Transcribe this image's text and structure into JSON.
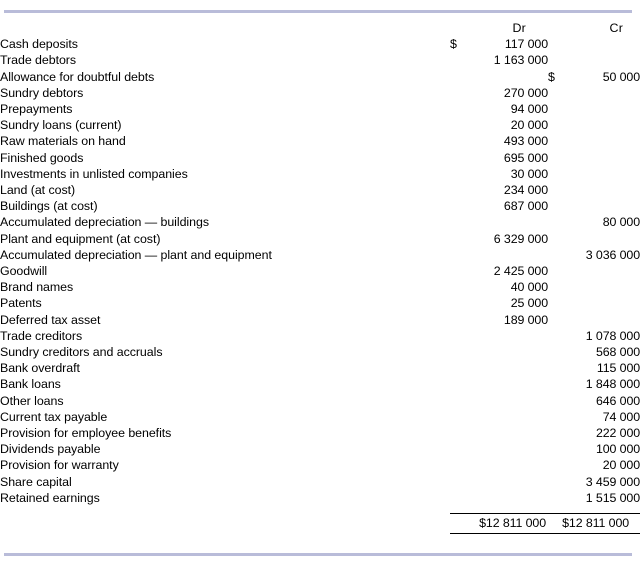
{
  "table": {
    "columns": {
      "label_header": "",
      "dr_header": "Dr",
      "cr_header": "Cr"
    },
    "currency_symbol": "$",
    "rows": [
      {
        "label": "Cash deposits",
        "dr_symbol": "$",
        "dr": "117 000",
        "cr_symbol": "",
        "cr": ""
      },
      {
        "label": "Trade debtors",
        "dr_symbol": "",
        "dr": "1 163 000",
        "cr_symbol": "",
        "cr": ""
      },
      {
        "label": "Allowance for doubtful debts",
        "dr_symbol": "",
        "dr": "",
        "cr_symbol": "$",
        "cr": "50 000"
      },
      {
        "label": "Sundry debtors",
        "dr_symbol": "",
        "dr": "270 000",
        "cr_symbol": "",
        "cr": ""
      },
      {
        "label": "Prepayments",
        "dr_symbol": "",
        "dr": "94 000",
        "cr_symbol": "",
        "cr": ""
      },
      {
        "label": "Sundry loans (current)",
        "dr_symbol": "",
        "dr": "20 000",
        "cr_symbol": "",
        "cr": ""
      },
      {
        "label": "Raw materials on hand",
        "dr_symbol": "",
        "dr": "493 000",
        "cr_symbol": "",
        "cr": ""
      },
      {
        "label": "Finished goods",
        "dr_symbol": "",
        "dr": "695 000",
        "cr_symbol": "",
        "cr": ""
      },
      {
        "label": "Investments in unlisted companies",
        "dr_symbol": "",
        "dr": "30 000",
        "cr_symbol": "",
        "cr": ""
      },
      {
        "label": "Land (at cost)",
        "dr_symbol": "",
        "dr": "234 000",
        "cr_symbol": "",
        "cr": ""
      },
      {
        "label": "Buildings (at cost)",
        "dr_symbol": "",
        "dr": "687 000",
        "cr_symbol": "",
        "cr": ""
      },
      {
        "label": "Accumulated depreciation — buildings",
        "dr_symbol": "",
        "dr": "",
        "cr_symbol": "",
        "cr": "80 000"
      },
      {
        "label": "Plant and equipment (at cost)",
        "dr_symbol": "",
        "dr": "6 329 000",
        "cr_symbol": "",
        "cr": ""
      },
      {
        "label": "Accumulated depreciation — plant and equipment",
        "dr_symbol": "",
        "dr": "",
        "cr_symbol": "",
        "cr": "3 036 000"
      },
      {
        "label": "Goodwill",
        "dr_symbol": "",
        "dr": "2 425 000",
        "cr_symbol": "",
        "cr": ""
      },
      {
        "label": "Brand names",
        "dr_symbol": "",
        "dr": "40 000",
        "cr_symbol": "",
        "cr": ""
      },
      {
        "label": "Patents",
        "dr_symbol": "",
        "dr": "25 000",
        "cr_symbol": "",
        "cr": ""
      },
      {
        "label": "Deferred tax asset",
        "dr_symbol": "",
        "dr": "189 000",
        "cr_symbol": "",
        "cr": ""
      },
      {
        "label": "Trade creditors",
        "dr_symbol": "",
        "dr": "",
        "cr_symbol": "",
        "cr": "1 078 000"
      },
      {
        "label": "Sundry creditors and accruals",
        "dr_symbol": "",
        "dr": "",
        "cr_symbol": "",
        "cr": "568 000"
      },
      {
        "label": "Bank overdraft",
        "dr_symbol": "",
        "dr": "",
        "cr_symbol": "",
        "cr": "115 000"
      },
      {
        "label": "Bank loans",
        "dr_symbol": "",
        "dr": "",
        "cr_symbol": "",
        "cr": "1 848 000"
      },
      {
        "label": "Other loans",
        "dr_symbol": "",
        "dr": "",
        "cr_symbol": "",
        "cr": "646 000"
      },
      {
        "label": "Current tax payable",
        "dr_symbol": "",
        "dr": "",
        "cr_symbol": "",
        "cr": "74 000"
      },
      {
        "label": "Provision for employee benefits",
        "dr_symbol": "",
        "dr": "",
        "cr_symbol": "",
        "cr": "222 000"
      },
      {
        "label": "Dividends payable",
        "dr_symbol": "",
        "dr": "",
        "cr_symbol": "",
        "cr": "100 000"
      },
      {
        "label": "Provision for warranty",
        "dr_symbol": "",
        "dr": "",
        "cr_symbol": "",
        "cr": "20 000"
      },
      {
        "label": "Share capital",
        "dr_symbol": "",
        "dr": "",
        "cr_symbol": "",
        "cr": "3 459 000"
      },
      {
        "label": "Retained earnings",
        "dr_symbol": "",
        "dr": "",
        "cr_symbol": "",
        "cr": "1 515 000"
      }
    ],
    "totals": {
      "label": "",
      "dr": "$12 811 000",
      "cr": "$12 811 000"
    }
  },
  "style": {
    "edge_rule_color": "#b9bcd9",
    "text_color": "#000000",
    "background_color": "#ffffff"
  }
}
